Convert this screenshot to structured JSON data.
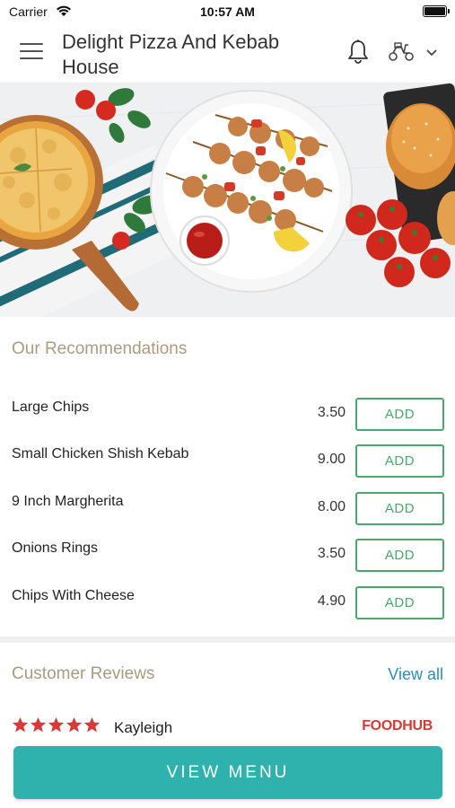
{
  "status_bar": {
    "carrier": "Carrier",
    "time": "10:57 AM"
  },
  "header": {
    "title": "Delight Pizza And Kebab House",
    "icons": [
      "hamburger-menu-icon",
      "bell-icon",
      "scooter-icon",
      "chevron-down-icon"
    ]
  },
  "hero": {
    "image_description_icons": [
      "pizza-image",
      "kebab-plate-image",
      "burger-image",
      "tomatoes-image"
    ]
  },
  "recommendations": {
    "title": "Our Recommendations",
    "add_label": "ADD",
    "items": [
      {
        "name": "Large Chips",
        "price": "3.50"
      },
      {
        "name": "Small Chicken Shish Kebab",
        "price": "9.00"
      },
      {
        "name": "9 Inch Margherita",
        "price": "8.00"
      },
      {
        "name": "Onions Rings",
        "price": "3.50"
      },
      {
        "name": "Chips With Cheese",
        "price": "4.90"
      }
    ]
  },
  "reviews": {
    "title": "Customer Reviews",
    "view_all": "View all",
    "first_review": {
      "rating": 5,
      "reviewer": "Kayleigh",
      "source": "FOODHUB"
    }
  },
  "cta": {
    "label": "VIEW MENU"
  },
  "colors": {
    "accent_teal": "#2fb1ad",
    "add_green": "#4aa86a",
    "section_title": "#a99b82",
    "link_blue": "#2a8fb8",
    "star_red": "#d83a3a",
    "foodhub_red": "#d43a34"
  }
}
